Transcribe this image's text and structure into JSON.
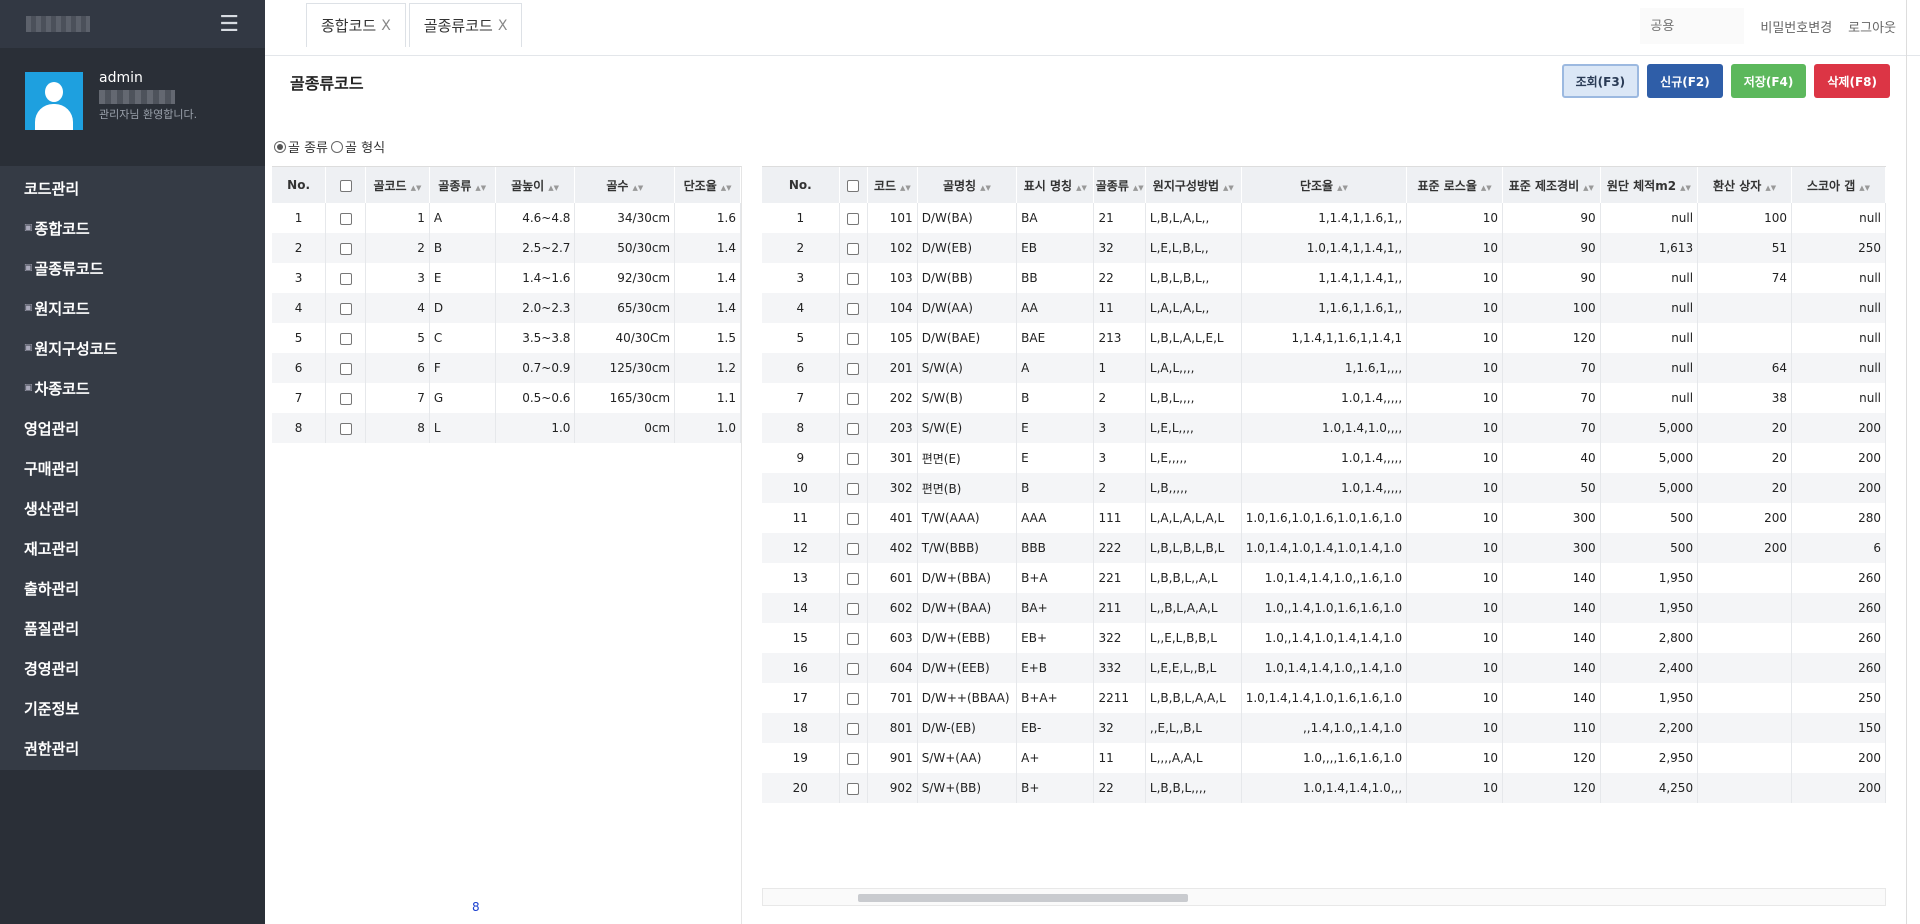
{
  "header": {
    "menu_icon": "hamburger-icon"
  },
  "profile": {
    "username": "admin",
    "greeting": "관리자님 환영합니다."
  },
  "nav": {
    "items": [
      {
        "label": "코드관리",
        "sub": false
      },
      {
        "label": "종합코드",
        "sub": true
      },
      {
        "label": "골종류코드",
        "sub": true
      },
      {
        "label": "원지코드",
        "sub": true
      },
      {
        "label": "원지구성코드",
        "sub": true
      },
      {
        "label": "차종코드",
        "sub": true
      },
      {
        "label": "영업관리",
        "sub": false
      },
      {
        "label": "구매관리",
        "sub": false
      },
      {
        "label": "생산관리",
        "sub": false
      },
      {
        "label": "재고관리",
        "sub": false
      },
      {
        "label": "출하관리",
        "sub": false
      },
      {
        "label": "품질관리",
        "sub": false
      },
      {
        "label": "경영관리",
        "sub": false
      },
      {
        "label": "기준정보",
        "sub": false
      },
      {
        "label": "권한관리",
        "sub": false
      }
    ]
  },
  "tabs": [
    {
      "label": "종합코드",
      "close": "X"
    },
    {
      "label": "골종류코드",
      "close": "X"
    }
  ],
  "topbar": {
    "search_placeholder": "공용",
    "change_pw": "비밀번호변경",
    "logout": "로그아웃"
  },
  "page": {
    "title": "골종류코드"
  },
  "buttons": {
    "query": "조회(F3)",
    "new": "신규(F2)",
    "save": "저장(F4)",
    "delete": "삭제(F8)"
  },
  "radios": {
    "opt1": "골 종류",
    "opt2": "골 형식"
  },
  "left_grid": {
    "headers": [
      "No.",
      "",
      "골코드",
      "골종류",
      "골높이",
      "골수",
      "단조율"
    ],
    "rows": [
      [
        "1",
        "",
        "1",
        "A",
        "4.6~4.8",
        "34/30cm",
        "1.6"
      ],
      [
        "2",
        "",
        "2",
        "B",
        "2.5~2.7",
        "50/30cm",
        "1.4"
      ],
      [
        "3",
        "",
        "3",
        "E",
        "1.4~1.6",
        "92/30cm",
        "1.4"
      ],
      [
        "4",
        "",
        "4",
        "D",
        "2.0~2.3",
        "65/30cm",
        "1.4"
      ],
      [
        "5",
        "",
        "5",
        "C",
        "3.5~3.8",
        "40/30Cm",
        "1.5"
      ],
      [
        "6",
        "",
        "6",
        "F",
        "0.7~0.9",
        "125/30cm",
        "1.2"
      ],
      [
        "7",
        "",
        "7",
        "G",
        "0.5~0.6",
        "165/30cm",
        "1.1"
      ],
      [
        "8",
        "",
        "8",
        "L",
        "1.0",
        "0cm",
        "1.0"
      ]
    ],
    "count": "8"
  },
  "right_grid": {
    "headers": [
      "No.",
      "",
      "코드",
      "골명칭",
      "표시 명칭",
      "골종류",
      "원지구성방법",
      "단조율",
      "표준 로스율",
      "표준 제조경비",
      "원단 체적m2",
      "환산 상자",
      "스코아 갭"
    ],
    "rows": [
      [
        "1",
        "",
        "101",
        "D/W(BA)",
        "BA",
        "21",
        "L,B,L,A,L,,",
        "1,1.4,1,1.6,1,,",
        "10",
        "90",
        "null",
        "100",
        "null"
      ],
      [
        "2",
        "",
        "102",
        "D/W(EB)",
        "EB",
        "32",
        "L,E,L,B,L,,",
        "1.0,1.4,1,1.4,1,,",
        "10",
        "90",
        "1,613",
        "51",
        "250"
      ],
      [
        "3",
        "",
        "103",
        "D/W(BB)",
        "BB",
        "22",
        "L,B,L,B,L,,",
        "1,1.4,1,1.4,1,,",
        "10",
        "90",
        "null",
        "74",
        "null"
      ],
      [
        "4",
        "",
        "104",
        "D/W(AA)",
        "AA",
        "11",
        "L,A,L,A,L,,",
        "1,1.6,1,1.6,1,,",
        "10",
        "100",
        "null",
        "",
        "null"
      ],
      [
        "5",
        "",
        "105",
        "D/W(BAE)",
        "BAE",
        "213",
        "L,B,L,A,L,E,L",
        "1,1.4,1,1.6,1,1.4,1",
        "10",
        "120",
        "null",
        "",
        "null"
      ],
      [
        "6",
        "",
        "201",
        "S/W(A)",
        "A",
        "1",
        "L,A,L,,,,",
        "1,1.6,1,,,,",
        "10",
        "70",
        "null",
        "64",
        "null"
      ],
      [
        "7",
        "",
        "202",
        "S/W(B)",
        "B",
        "2",
        "L,B,L,,,,",
        "1.0,1.4,,,,,",
        "10",
        "70",
        "null",
        "38",
        "null"
      ],
      [
        "8",
        "",
        "203",
        "S/W(E)",
        "E",
        "3",
        "L,E,L,,,,",
        "1.0,1.4,1.0,,,,",
        "10",
        "70",
        "5,000",
        "20",
        "200"
      ],
      [
        "9",
        "",
        "301",
        "편면(E)",
        "E",
        "3",
        "L,E,,,,,",
        "1.0,1.4,,,,,",
        "10",
        "40",
        "5,000",
        "20",
        "200"
      ],
      [
        "10",
        "",
        "302",
        "편면(B)",
        "B",
        "2",
        "L,B,,,,,",
        "1.0,1.4,,,,,",
        "10",
        "50",
        "5,000",
        "20",
        "200"
      ],
      [
        "11",
        "",
        "401",
        "T/W(AAA)",
        "AAA",
        "111",
        "L,A,L,A,L,A,L",
        "1.0,1.6,1.0,1.6,1.0,1.6,1.0",
        "10",
        "300",
        "500",
        "200",
        "280"
      ],
      [
        "12",
        "",
        "402",
        "T/W(BBB)",
        "BBB",
        "222",
        "L,B,L,B,L,B,L",
        "1.0,1.4,1.0,1.4,1.0,1.4,1.0",
        "10",
        "300",
        "500",
        "200",
        "6"
      ],
      [
        "13",
        "",
        "601",
        "D/W+(BBA)",
        "B+A",
        "221",
        "L,B,B,L,,A,L",
        "1.0,1.4,1.4,1.0,,1.6,1.0",
        "10",
        "140",
        "1,950",
        "",
        "260"
      ],
      [
        "14",
        "",
        "602",
        "D/W+(BAA)",
        "BA+",
        "211",
        "L,,B,L,A,A,L",
        "1.0,,1.4,1.0,1.6,1.6,1.0",
        "10",
        "140",
        "1,950",
        "",
        "260"
      ],
      [
        "15",
        "",
        "603",
        "D/W+(EBB)",
        "EB+",
        "322",
        "L,,E,L,B,B,L",
        "1.0,,1.4,1.0,1.4,1.4,1.0",
        "10",
        "140",
        "2,800",
        "",
        "260"
      ],
      [
        "16",
        "",
        "604",
        "D/W+(EEB)",
        "E+B",
        "332",
        "L,E,E,L,,B,L",
        "1.0,1.4,1.4,1.0,,1.4,1.0",
        "10",
        "140",
        "2,400",
        "",
        "260"
      ],
      [
        "17",
        "",
        "701",
        "D/W++(BBAA)",
        "B+A+",
        "2211",
        "L,B,B,L,A,A,L",
        "1.0,1.4,1.4,1.0,1.6,1.6,1.0",
        "10",
        "140",
        "1,950",
        "",
        "250"
      ],
      [
        "18",
        "",
        "801",
        "D/W-(EB)",
        "EB-",
        "32",
        ",,E,L,,B,L",
        ",,1.4,1.0,,1.4,1.0",
        "10",
        "110",
        "2,200",
        "",
        "150"
      ],
      [
        "19",
        "",
        "901",
        "S/W+(AA)",
        "A+",
        "11",
        "L,,,,A,A,L",
        "1.0,,,,1.6,1.6,1.0",
        "10",
        "120",
        "2,950",
        "",
        "200"
      ],
      [
        "20",
        "",
        "902",
        "S/W+(BB)",
        "B+",
        "22",
        "L,B,B,L,,,,",
        "1.0,1.4,1.4,1.0,,,",
        "10",
        "120",
        "4,250",
        "",
        "200"
      ]
    ]
  }
}
